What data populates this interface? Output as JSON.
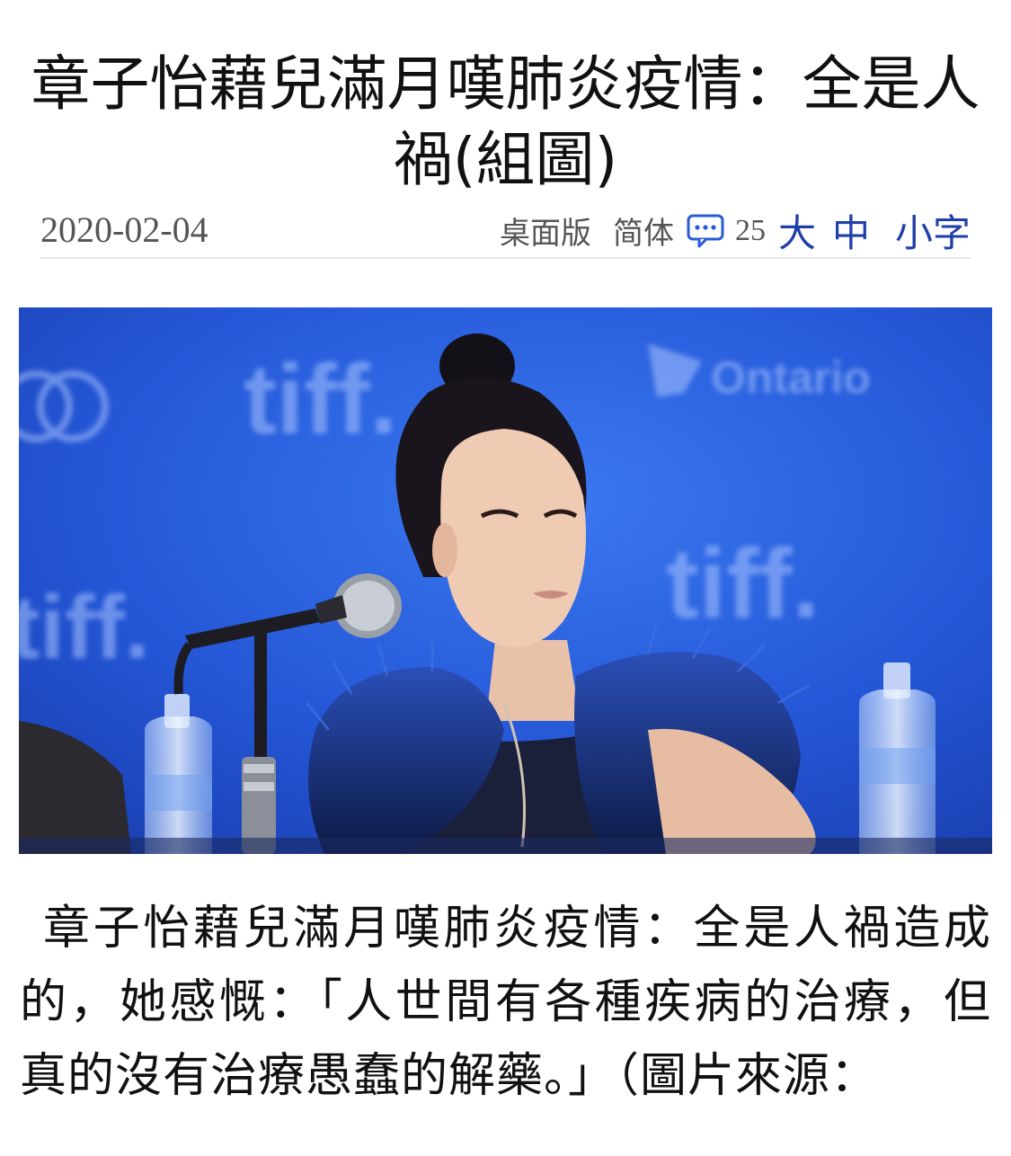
{
  "article": {
    "title": "章子怡藉兒滿月嘆肺炎疫情：全是人禍(組圖)",
    "date": "2020-02-04",
    "body": "章子怡藉兒滿月嘆肺炎疫情：全是人禍造成的，她感慨：「人世間有各種疾病的治療，但真的沒有治療愚蠢的解藥。」（圖片來源："
  },
  "toolbar": {
    "desktop_label": "桌面版",
    "simplified_label": "简体",
    "comment_icon": "comment-bubble-icon",
    "comment_count": "25",
    "font_large_label": "大",
    "font_medium_label": "中",
    "font_small_label": "小字"
  },
  "photo": {
    "backdrop_logo_text": "tiff.",
    "sponsor_text": "Ontario"
  },
  "colors": {
    "accent": "#1f3fa8",
    "meta_text": "#555555",
    "divider": "#e6e6e6",
    "photo_backdrop": "#1f4fd0"
  }
}
